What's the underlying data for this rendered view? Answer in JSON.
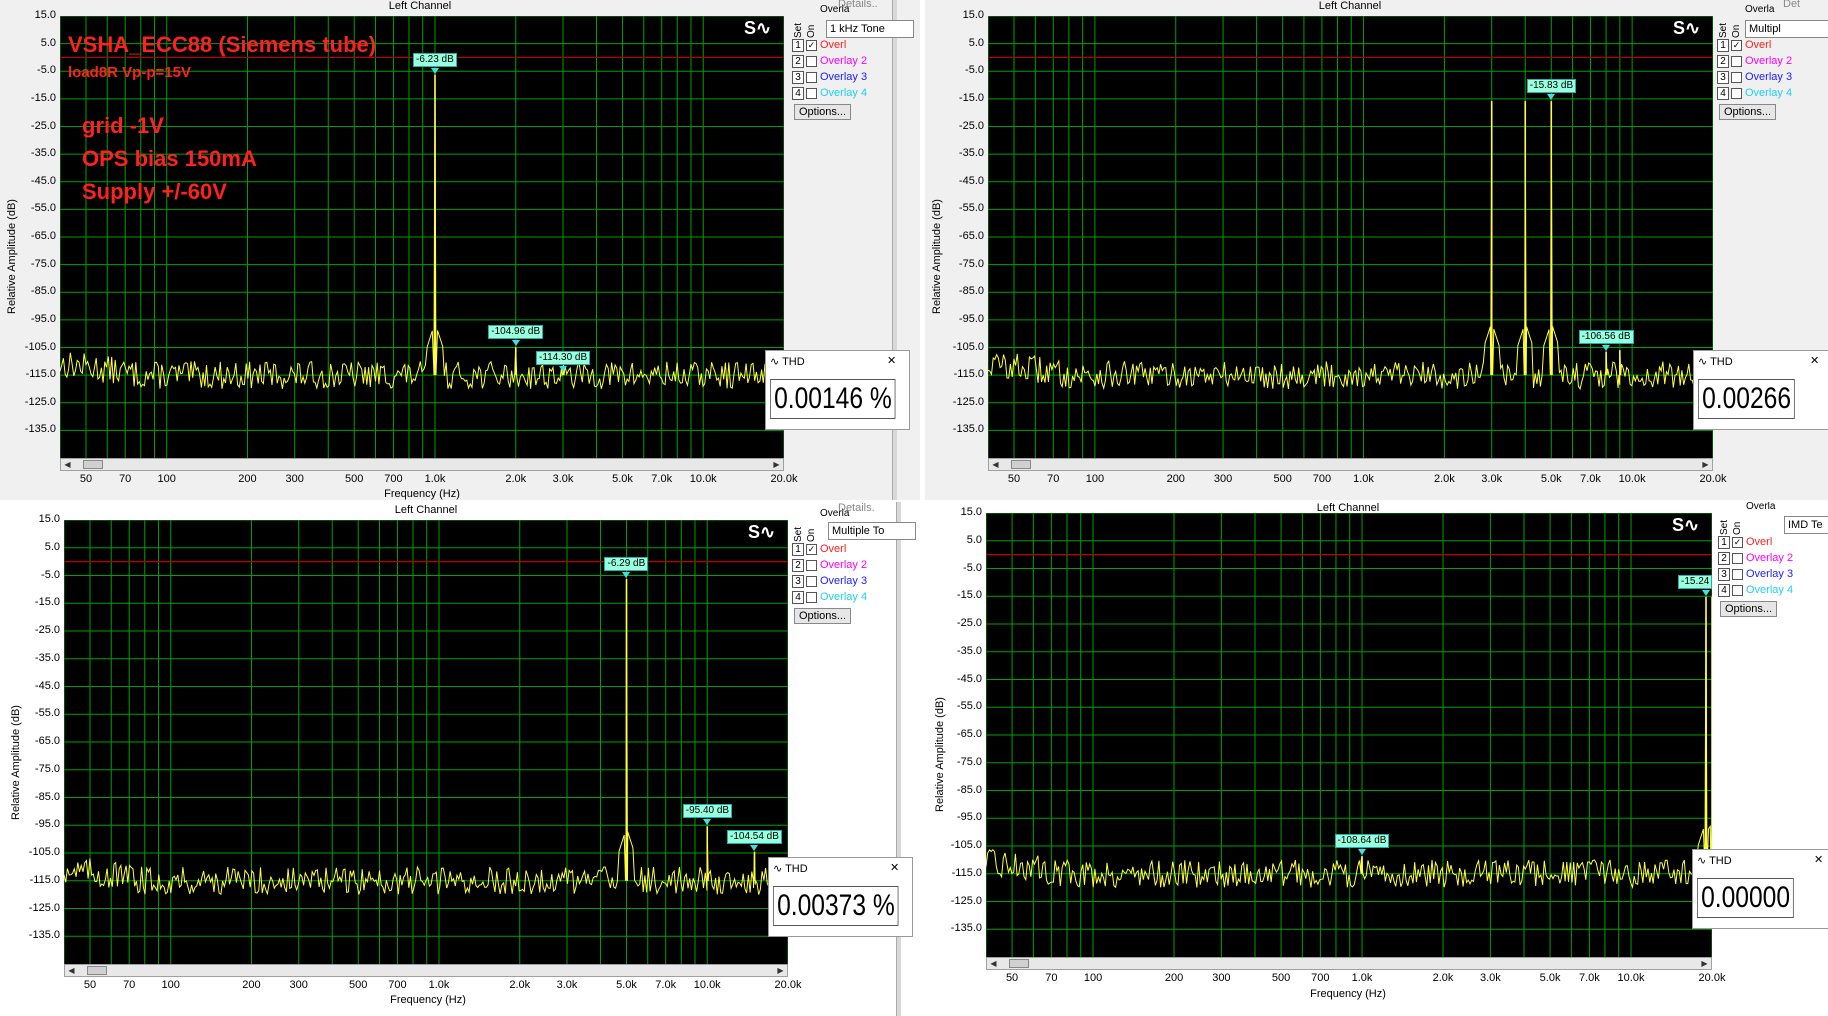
{
  "panels": [
    {
      "id": "top-left",
      "title": "Left Channel",
      "ylabel": "Relative Amplitude (dB)",
      "xlabel": "Frequency (Hz)",
      "combo": "1 kHz Tone",
      "details": "Details..",
      "overlay_head": "Overla",
      "thd_label": "THD",
      "thd_value": "0.00146 %",
      "annotations": {
        "title": "VSHA_ECC88 (Siemens tube)",
        "subtitle": "load8R Vp-p=15V",
        "line1": "grid -1V",
        "line2": "OPS bias 150mA",
        "line3": "Supply +/-60V"
      }
    },
    {
      "id": "top-right",
      "title": "Left Channel",
      "ylabel": "Relative Amplitude (dB)",
      "xlabel": "",
      "combo": "Multipl",
      "details": "Det",
      "overlay_head": "Overla",
      "thd_label": "THD",
      "thd_value": "0.00266"
    },
    {
      "id": "bottom-left",
      "title": "Left Channel",
      "ylabel": "Relative Amplitude (dB)",
      "xlabel": "Frequency (Hz)",
      "combo": "Multiple To",
      "details": "Details.",
      "overlay_head": "Overla",
      "thd_label": "THD",
      "thd_value": "0.00373 %"
    },
    {
      "id": "bottom-right",
      "title": "Left Channel",
      "ylabel": "Relative Amplitude (dB)",
      "xlabel": "Frequency (Hz)",
      "combo": "IMD Te",
      "details": "",
      "overlay_head": "Overla",
      "thd_label": "THD",
      "thd_value": "0.00000"
    }
  ],
  "overlay": {
    "set_label": "Set",
    "on_label": "On",
    "rows": [
      {
        "num": "1",
        "label": "Overl",
        "checked": true,
        "color": "#ff2020"
      },
      {
        "num": "2",
        "label": "Overlay 2",
        "checked": false,
        "color": "#ff00ff"
      },
      {
        "num": "3",
        "label": "Overlay 3",
        "checked": false,
        "color": "#2020ff"
      },
      {
        "num": "4",
        "label": "Overlay 4",
        "checked": false,
        "color": "#20d0f0"
      }
    ],
    "options_label": "Options..."
  },
  "colors": {
    "trace": "#ffff40",
    "grid": "#00a000",
    "refline": "#c00000",
    "marker": "#40e0e0",
    "annotation": "#ff2020"
  },
  "chart_data": [
    {
      "type": "line",
      "title": "Left Channel",
      "xlabel": "Frequency (Hz)",
      "ylabel": "Relative Amplitude (dB)",
      "xscale": "log",
      "xlim": [
        40,
        20000
      ],
      "ylim": [
        -145,
        15
      ],
      "reference_level_db": 0,
      "y_ticks": [
        "15.0",
        "5.0",
        "-5.0",
        "-15.0",
        "-25.0",
        "-35.0",
        "-45.0",
        "-55.0",
        "-65.0",
        "-75.0",
        "-85.0",
        "-95.0",
        "-105.0",
        "-115.0",
        "-125.0",
        "-135.0"
      ],
      "x_ticks": [
        {
          "v": 50,
          "t": "50"
        },
        {
          "v": 70,
          "t": "70"
        },
        {
          "v": 100,
          "t": "100"
        },
        {
          "v": 200,
          "t": "200"
        },
        {
          "v": 300,
          "t": "300"
        },
        {
          "v": 500,
          "t": "500"
        },
        {
          "v": 700,
          "t": "700"
        },
        {
          "v": 1000,
          "t": "1.0k"
        },
        {
          "v": 2000,
          "t": "2.0k"
        },
        {
          "v": 3000,
          "t": "3.0k"
        },
        {
          "v": 5000,
          "t": "5.0k"
        },
        {
          "v": 7000,
          "t": "7.0k"
        },
        {
          "v": 10000,
          "t": "10.0k"
        },
        {
          "v": 20000,
          "t": "20.0k"
        }
      ],
      "noise_floor_db": -115,
      "peaks": [
        {
          "f": 1000,
          "db": -6.23
        },
        {
          "f": 2000,
          "db": -104.96
        },
        {
          "f": 3000,
          "db": -114.3
        }
      ],
      "markers": [
        {
          "f": 1000,
          "db": -6.23,
          "label": "-6.23 dB"
        },
        {
          "f": 2000,
          "db": -104.96,
          "label": "-104.96 dB"
        },
        {
          "f": 3000,
          "db": -114.3,
          "label": "-114.30 dB"
        }
      ],
      "thd_percent": "0.00146"
    },
    {
      "type": "line",
      "title": "Left Channel",
      "xlabel": "",
      "ylabel": "Relative Amplitude (dB)",
      "xscale": "log",
      "xlim": [
        40,
        20000
      ],
      "ylim": [
        -145,
        15
      ],
      "reference_level_db": 0,
      "y_ticks": [
        "15.0",
        "5.0",
        "-5.0",
        "-15.0",
        "-25.0",
        "-35.0",
        "-45.0",
        "-55.0",
        "-65.0",
        "-75.0",
        "-85.0",
        "-95.0",
        "-105.0",
        "-115.0",
        "-125.0",
        "-135.0"
      ],
      "x_ticks": [
        {
          "v": 50,
          "t": "50"
        },
        {
          "v": 70,
          "t": "70"
        },
        {
          "v": 100,
          "t": "100"
        },
        {
          "v": 200,
          "t": "200"
        },
        {
          "v": 300,
          "t": "300"
        },
        {
          "v": 500,
          "t": "500"
        },
        {
          "v": 700,
          "t": "700"
        },
        {
          "v": 1000,
          "t": "1.0k"
        },
        {
          "v": 2000,
          "t": "2.0k"
        },
        {
          "v": 3000,
          "t": "3.0k"
        },
        {
          "v": 5000,
          "t": "5.0k"
        },
        {
          "v": 7000,
          "t": "7.0k"
        },
        {
          "v": 10000,
          "t": "10.0k"
        },
        {
          "v": 20000,
          "t": "20.0k"
        }
      ],
      "noise_floor_db": -115,
      "peaks": [
        {
          "f": 3000,
          "db": -15.8
        },
        {
          "f": 4000,
          "db": -15.8
        },
        {
          "f": 5000,
          "db": -15.83
        },
        {
          "f": 8000,
          "db": -106.56
        },
        {
          "f": 9000,
          "db": -106
        }
      ],
      "markers": [
        {
          "f": 5000,
          "db": -15.83,
          "label": "-15.83 dB"
        },
        {
          "f": 8000,
          "db": -106.56,
          "label": "-106.56 dB"
        }
      ],
      "thd_percent": "0.00266"
    },
    {
      "type": "line",
      "title": "Left Channel",
      "xlabel": "Frequency (Hz)",
      "ylabel": "Relative Amplitude (dB)",
      "xscale": "log",
      "xlim": [
        40,
        20000
      ],
      "ylim": [
        -145,
        15
      ],
      "reference_level_db": 0,
      "y_ticks": [
        "15.0",
        "5.0",
        "-5.0",
        "-15.0",
        "-25.0",
        "-35.0",
        "-45.0",
        "-55.0",
        "-65.0",
        "-75.0",
        "-85.0",
        "-95.0",
        "-105.0",
        "-115.0",
        "-125.0",
        "-135.0"
      ],
      "x_ticks": [
        {
          "v": 50,
          "t": "50"
        },
        {
          "v": 70,
          "t": "70"
        },
        {
          "v": 100,
          "t": "100"
        },
        {
          "v": 200,
          "t": "200"
        },
        {
          "v": 300,
          "t": "300"
        },
        {
          "v": 500,
          "t": "500"
        },
        {
          "v": 700,
          "t": "700"
        },
        {
          "v": 1000,
          "t": "1.0k"
        },
        {
          "v": 2000,
          "t": "2.0k"
        },
        {
          "v": 3000,
          "t": "3.0k"
        },
        {
          "v": 5000,
          "t": "5.0k"
        },
        {
          "v": 7000,
          "t": "7.0k"
        },
        {
          "v": 10000,
          "t": "10.0k"
        },
        {
          "v": 20000,
          "t": "20.0k"
        }
      ],
      "noise_floor_db": -115,
      "peaks": [
        {
          "f": 5000,
          "db": -6.29
        },
        {
          "f": 10000,
          "db": -95.4
        },
        {
          "f": 15000,
          "db": -104.54
        }
      ],
      "markers": [
        {
          "f": 5000,
          "db": -6.29,
          "label": "-6.29 dB"
        },
        {
          "f": 10000,
          "db": -95.4,
          "label": "-95.40 dB"
        },
        {
          "f": 15000,
          "db": -104.54,
          "label": "-104.54 dB"
        }
      ],
      "thd_percent": "0.00373"
    },
    {
      "type": "line",
      "title": "Left Channel",
      "xlabel": "Frequency (Hz)",
      "ylabel": "Relative Amplitude (dB)",
      "xscale": "log",
      "xlim": [
        40,
        20000
      ],
      "ylim": [
        -145,
        15
      ],
      "reference_level_db": 0,
      "y_ticks": [
        "15.0",
        "5.0",
        "-5.0",
        "-15.0",
        "-25.0",
        "-35.0",
        "-45.0",
        "-55.0",
        "-65.0",
        "-75.0",
        "-85.0",
        "-95.0",
        "-105.0",
        "-115.0",
        "-125.0",
        "-135.0"
      ],
      "x_ticks": [
        {
          "v": 50,
          "t": "50"
        },
        {
          "v": 70,
          "t": "70"
        },
        {
          "v": 100,
          "t": "100"
        },
        {
          "v": 200,
          "t": "200"
        },
        {
          "v": 300,
          "t": "300"
        },
        {
          "v": 500,
          "t": "500"
        },
        {
          "v": 700,
          "t": "700"
        },
        {
          "v": 1000,
          "t": "1.0k"
        },
        {
          "v": 2000,
          "t": "2.0k"
        },
        {
          "v": 3000,
          "t": "3.0k"
        },
        {
          "v": 5000,
          "t": "5.0k"
        },
        {
          "v": 7000,
          "t": "7.0k"
        },
        {
          "v": 10000,
          "t": "10.0k"
        },
        {
          "v": 20000,
          "t": "20.0k"
        }
      ],
      "noise_floor_db": -115,
      "peaks": [
        {
          "f": 1000,
          "db": -108.64
        },
        {
          "f": 19000,
          "db": -15.24
        },
        {
          "f": 20000,
          "db": -15.24
        }
      ],
      "markers": [
        {
          "f": 1000,
          "db": -108.64,
          "label": "-108.64 dB"
        },
        {
          "f": 19000,
          "db": -15.24,
          "label": "-15.24"
        }
      ],
      "thd_percent": "0.00000"
    }
  ]
}
